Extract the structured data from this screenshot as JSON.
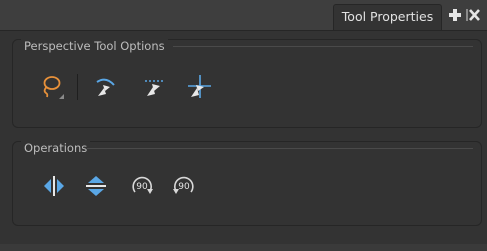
{
  "tab": {
    "title": "Tool Properties"
  },
  "tab_buttons": {
    "add": "add-panel",
    "close": "close-panel"
  },
  "groups": {
    "perspective": {
      "title": "Perspective Tool Options",
      "tools": [
        "lasso",
        "perspective-1",
        "perspective-2",
        "perspective-3"
      ]
    },
    "operations": {
      "title": "Operations",
      "tools": [
        "flip-horizontal",
        "flip-vertical",
        "rotate-90-cw",
        "rotate-90-ccw"
      ],
      "rotate_label": "90"
    }
  },
  "colors": {
    "accent_orange": "#e8913a",
    "accent_blue": "#5aa7e6",
    "icon_white": "#e8e8e8"
  }
}
